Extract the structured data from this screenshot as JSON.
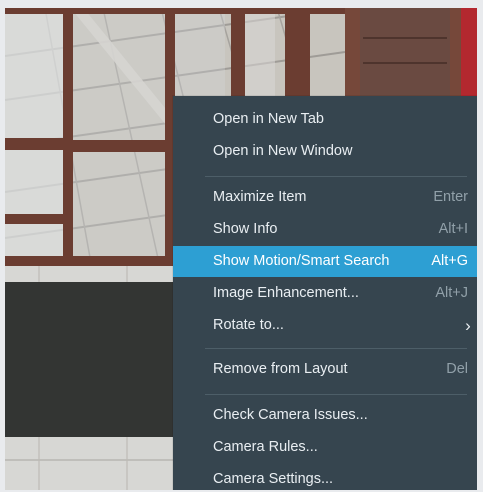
{
  "context_menu": {
    "items": [
      {
        "label": "Open in New Tab",
        "shortcut": ""
      },
      {
        "label": "Open in New Window",
        "shortcut": ""
      },
      {
        "label": "Maximize Item",
        "shortcut": "Enter"
      },
      {
        "label": "Show Info",
        "shortcut": "Alt+I"
      },
      {
        "label": "Show Motion/Smart Search",
        "shortcut": "Alt+G",
        "highlighted": true
      },
      {
        "label": "Image Enhancement...",
        "shortcut": "Alt+J"
      },
      {
        "label": "Rotate to...",
        "shortcut": "",
        "submenu_icon": "chevron-right-icon"
      },
      {
        "label": "Remove from Layout",
        "shortcut": "Del"
      },
      {
        "label": "Check Camera Issues...",
        "shortcut": ""
      },
      {
        "label": "Camera Rules...",
        "shortcut": ""
      },
      {
        "label": "Camera Settings...",
        "shortcut": ""
      }
    ]
  },
  "colors": {
    "menu_background": "#36454f",
    "highlight": "#2d9fd3",
    "menu_text": "#e9eef2",
    "shortcut_text": "#91a0a9"
  }
}
